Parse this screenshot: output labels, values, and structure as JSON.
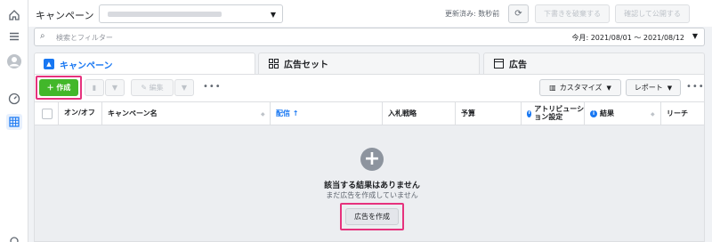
{
  "header": {
    "title": "キャンペーン",
    "updated": "更新済み: 数秒前",
    "btn_review_drafts": "下書きを破棄する",
    "btn_confirm_publish": "確認して公開する"
  },
  "search": {
    "placeholder": "検索とフィルター",
    "date_range": "今月: 2021/08/01 ～ 2021/08/12"
  },
  "tabs": [
    {
      "label": "キャンペーン"
    },
    {
      "label": "広告セット"
    },
    {
      "label": "広告"
    }
  ],
  "toolbar": {
    "create": "＋ 作成",
    "edit": "✎ 編集",
    "customize": "カスタマイズ",
    "report": "レポート"
  },
  "table": {
    "columns": [
      "オン/オフ",
      "キャンペーン名",
      "配信 ↑",
      "入札戦略",
      "予算",
      "アトリビューション設定",
      "結果",
      "リーチ"
    ]
  },
  "empty_state": {
    "title": "該当する結果はありません",
    "subtitle": "まだ広告を作成していません",
    "button": "広告を作成"
  },
  "colors": {
    "accent_blue": "#1877f2",
    "create_green": "#42b72a",
    "highlight_pink": "#e6327d"
  }
}
